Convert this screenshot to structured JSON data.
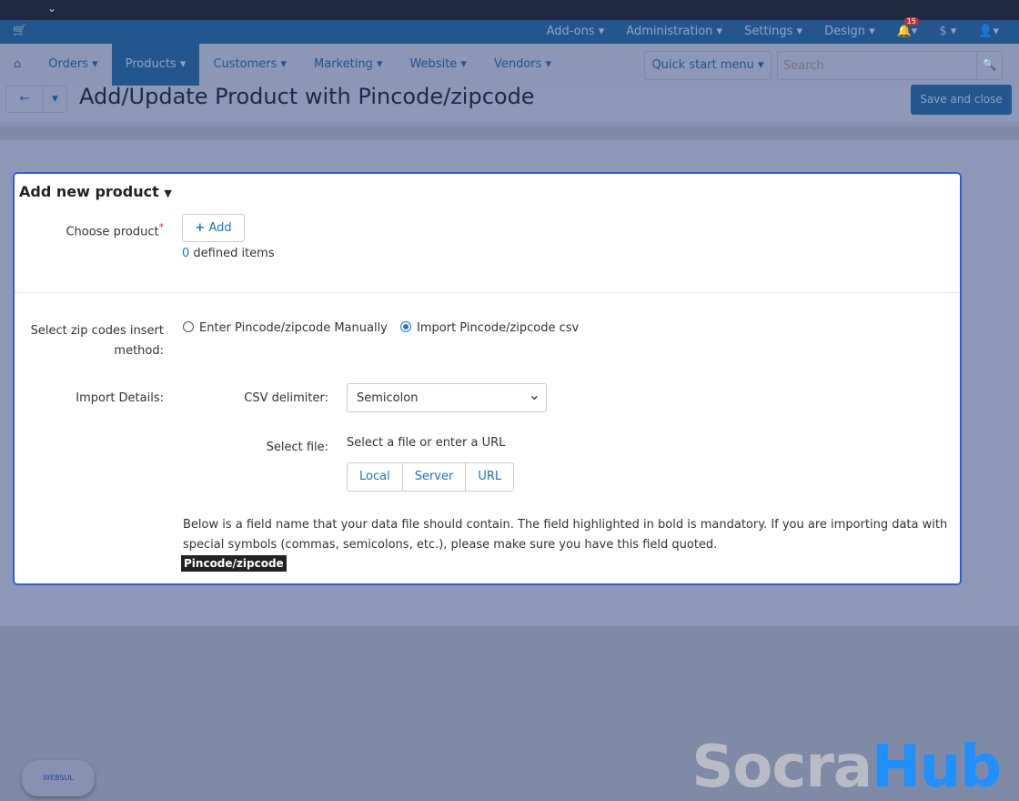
{
  "topbar": {
    "collapse_icon": "chevron-down-icon"
  },
  "nav_top": {
    "items": [
      "Add-ons ▾",
      "Administration ▾",
      "Settings ▾",
      "Design ▾"
    ],
    "notification_count": "15",
    "currency": "$ ▾",
    "user": "▾"
  },
  "nav_main": {
    "items": [
      "Orders ▾",
      "Products ▾",
      "Customers ▾",
      "Marketing ▾",
      "Website ▾",
      "Vendors ▾"
    ],
    "active": "Products",
    "quick_start": "Quick start menu ▾",
    "search_placeholder": "Search"
  },
  "page": {
    "title": "Add/Update Product with Pincode/zipcode",
    "save_label": "Save and close"
  },
  "panel": {
    "heading": "Add new product",
    "choose_product_label": "Choose product",
    "add_label": "Add",
    "defined_count": "0",
    "defined_text": " defined items",
    "method_label": "Select zip codes insert method:",
    "method_options": [
      "Enter Pincode/zipcode Manually",
      "Import Pincode/zipcode csv"
    ],
    "method_selected": 1,
    "import_label": "Import Details:",
    "csv_label": "CSV delimiter:",
    "csv_value": "Semicolon",
    "file_label": "Select file:",
    "file_hint": "Select a file or enter a URL",
    "file_sources": [
      "Local",
      "Server",
      "URL"
    ],
    "info": "Below is a field name that your data file should contain. The field highlighted in bold is mandatory. If you are importing data with special symbols (commas, semicolons, etc.), please make sure you have this field quoted.",
    "field_tag": "Pincode/zipcode"
  },
  "watermark": {
    "part1": "Socra",
    "part2": "Hub",
    "badge": "WEBSUL"
  }
}
